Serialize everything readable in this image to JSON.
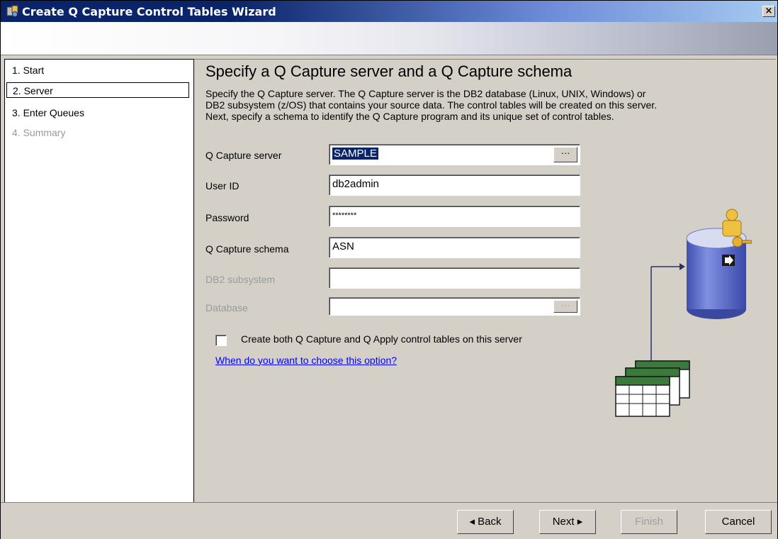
{
  "window": {
    "title": "Create Q Capture Control Tables Wizard",
    "close_glyph": "×"
  },
  "sidebar": {
    "items": [
      {
        "label": "1. Start",
        "state": "normal"
      },
      {
        "label": "2. Server",
        "state": "selected"
      },
      {
        "label": "3. Enter Queues",
        "state": "normal"
      },
      {
        "label": "4. Summary",
        "state": "disabled"
      }
    ]
  },
  "main": {
    "heading": "Specify a Q Capture server and a Q Capture schema",
    "description_lines": [
      "Specify the Q Capture server.  The Q Capture server is the DB2 database (Linux, UNIX, Windows) or",
      "DB2 subsystem (z/OS) that contains your source data. The control tables will be created on this server.",
      "Next, specify a schema to identify the Q Capture program and its unique set of control tables."
    ],
    "fields": {
      "server": {
        "label": "Q Capture server",
        "value": "SAMPLE",
        "browse": "···"
      },
      "user_id": {
        "label": "User ID",
        "value": "db2admin"
      },
      "password": {
        "label": "Password",
        "value": "********"
      },
      "schema": {
        "label": "Q Capture schema",
        "value": "ASN"
      },
      "db2_subsystem": {
        "label": "DB2 subsystem",
        "value": ""
      },
      "database": {
        "label": "Database",
        "value": "",
        "browse": "···"
      }
    },
    "checkbox_label": "Create both Q Capture and Q Apply control tables on this server",
    "checkbox_checked": false,
    "help_link": "When do you want to choose this option?"
  },
  "footer": {
    "back": "◂ Back",
    "next": "Next ▸",
    "finish": "Finish",
    "cancel": "Cancel"
  },
  "colors": {
    "titlebar": "#0a246a",
    "dialog_bg": "#d4d0c8",
    "selection": "#0a246a",
    "link": "#0000ff",
    "db_cylinder": "#5060b8",
    "table_header": "#3a7a3a"
  }
}
